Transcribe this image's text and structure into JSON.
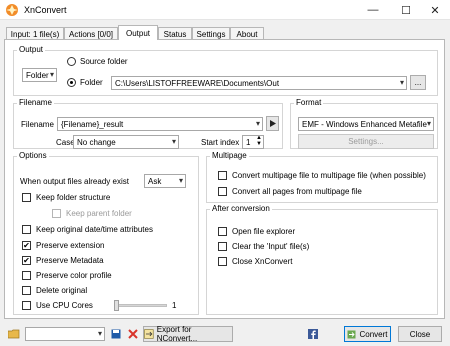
{
  "window": {
    "title": "XnConvert",
    "minimize_glyph": "—",
    "maximize_glyph": "☐",
    "close_glyph": "✕"
  },
  "tabs": [
    {
      "label": "Input: 1 file(s)",
      "active": false
    },
    {
      "label": "Actions [0/0]",
      "active": false
    },
    {
      "label": "Output",
      "active": true
    },
    {
      "label": "Status",
      "active": false
    },
    {
      "label": "Settings",
      "active": false
    },
    {
      "label": "About",
      "active": false
    }
  ],
  "output": {
    "group_title": "Output",
    "mode_select": "Folder",
    "source_folder_label": "Source folder",
    "folder_label": "Folder",
    "folder_path": "C:\\Users\\LISTOFFREEWARE\\Documents\\Out",
    "browse_label": "..."
  },
  "filename": {
    "group_title": "Filename",
    "filename_label": "Filename",
    "filename_value": "{Filename}_result",
    "case_label": "Case",
    "case_value": "No change",
    "start_index_label": "Start index",
    "start_index_value": "1"
  },
  "format": {
    "group_title": "Format",
    "format_value": "EMF - Windows Enhanced Metafile",
    "settings_label": "Settings..."
  },
  "options": {
    "group_title": "Options",
    "exist_label": "When output files already exist",
    "exist_value": "Ask",
    "keep_folder_structure": "Keep folder structure",
    "keep_parent_folder": "Keep parent folder",
    "keep_original_date": "Keep original date/time attributes",
    "preserve_extension": "Preserve extension",
    "preserve_metadata": "Preserve Metadata",
    "preserve_color_profile": "Preserve color profile",
    "delete_original": "Delete original",
    "use_cpu_cores": "Use CPU Cores",
    "cpu_cores_value": "1",
    "check_mark": "✔"
  },
  "multipage": {
    "group_title": "Multipage",
    "convert_to_multipage": "Convert multipage file to multipage file (when possible)",
    "convert_all_pages": "Convert all pages from multipage file"
  },
  "after_conversion": {
    "group_title": "After conversion",
    "open_explorer": "Open file explorer",
    "clear_input": "Clear the 'Input' file(s)",
    "close_app": "Close XnConvert"
  },
  "bottom": {
    "export_label": "Export for NConvert...",
    "convert_label": "Convert",
    "close_label": "Close",
    "dropdown_arrow": "▾"
  },
  "colors": {
    "accent": "#0078d7",
    "facebook_blue": "#3b5998",
    "delete_red": "#d9342b",
    "save_blue": "#1e5aa8",
    "folder_yellow": "#e8b84a"
  }
}
